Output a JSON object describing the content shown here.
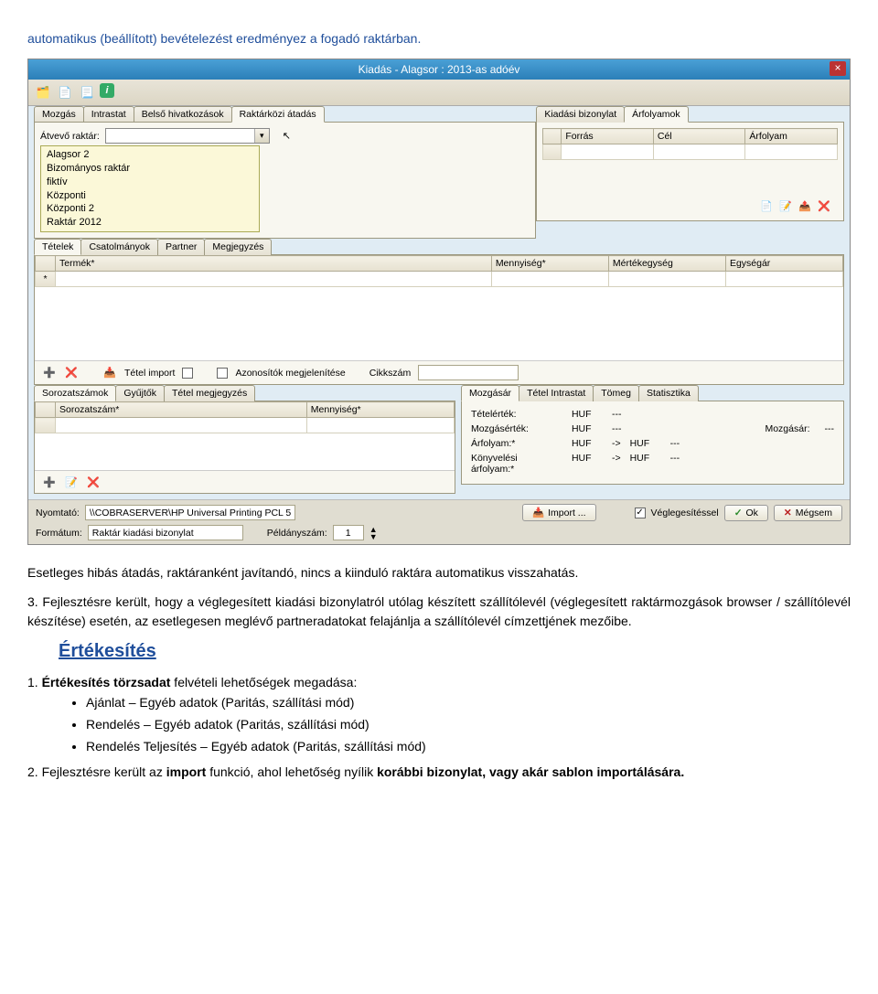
{
  "intro_text": "automatikus (beállított) bevételezést eredményez a fogadó raktárban.",
  "window": {
    "title": "Kiadás - Alagsor : 2013-as adóév",
    "tabs_upper_left": [
      "Mozgás",
      "Intrastat",
      "Belső hivatkozások",
      "Raktárközi átadás"
    ],
    "active_upper_left": "Raktárközi átadás",
    "tabs_upper_right": [
      "Kiadási bizonylat",
      "Árfolyamok"
    ],
    "active_upper_right": "Árfolyamok",
    "atvevo_label": "Átvevő raktár:",
    "dropdown_options": [
      "Alagsor 2",
      "Bizományos raktár",
      "fiktív",
      "Központi",
      "Központi 2",
      "Raktár 2012"
    ],
    "arf_cols": [
      "Forrás",
      "Cél",
      "Árfolyam"
    ],
    "tabs_items": [
      "Tételek",
      "Csatolmányok",
      "Partner",
      "Megjegyzés"
    ],
    "active_items_tab": "Tételek",
    "grid_cols": [
      "Termék*",
      "Mennyiség*",
      "Mértékegység",
      "Egységár"
    ],
    "tetel_import": "Tétel import",
    "azon_megjel": "Azonosítók megjelenítése",
    "cikkszam_label": "Cikkszám",
    "tabs_lower_left": [
      "Sorozatszámok",
      "Gyűjtők",
      "Tétel megjegyzés"
    ],
    "active_lower_left": "Sorozatszámok",
    "lower_left_cols": [
      "Sorozatszám*",
      "Mennyiség*"
    ],
    "tabs_lower_right": [
      "Mozgásár",
      "Tétel Intrastat",
      "Tömeg",
      "Statisztika"
    ],
    "active_lower_right": "Mozgásár",
    "stats": {
      "tetelerték": {
        "label": "Tételérték:",
        "curr": "HUF",
        "val": "---"
      },
      "mozgasertek": {
        "label": "Mozgásérték:",
        "curr": "HUF",
        "val": "---",
        "mozgasar_label": "Mozgásár:",
        "mozgasar_val": "---"
      },
      "arfolyam": {
        "label": "Árfolyam:*",
        "curr": "HUF",
        "arrow": "->",
        "curr2": "HUF",
        "val": "---"
      },
      "konyv": {
        "label": "Könyvelési árfolyam:*",
        "curr": "HUF",
        "arrow": "->",
        "curr2": "HUF",
        "val": "---"
      }
    },
    "footer": {
      "nyomtato_label": "Nyomtató:",
      "nyomtato_value": "\\\\COBRASERVER\\HP Universal Printing PCL 5",
      "formatum_label": "Formátum:",
      "formatum_value": "Raktár kiadási bizonylat",
      "peldany_label": "Példányszám:",
      "peldany_value": "1",
      "import_btn": "Import ...",
      "veglegesites_label": "Véglegesítéssel",
      "ok": "Ok",
      "megsem": "Mégsem"
    }
  },
  "doc": {
    "p_after_window": "Esetleges hibás átadás, raktáranként javítandó, nincs a kiinduló raktára automatikus visszahatás.",
    "p3_num": "3.",
    "p3_body": "Fejlesztésre került, hogy a véglegesített kiadási bizonylatról utólag készített szállítólevél (véglegesített raktármozgások browser / szállítólevél készítése) esetén, az esetlegesen meglévő partneradatokat felajánlja a szállítólevél címzettjének mezőibe.",
    "section": "Értékesítés",
    "p1_num": "1.",
    "p1_body": "Értékesítés törzsadat felvételi lehetőségek megadása:",
    "bullets": [
      "Ajánlat – Egyéb adatok (Paritás, szállítási mód)",
      "Rendelés – Egyéb adatok (Paritás, szállítási mód)",
      "Rendelés Teljesítés – Egyéb adatok (Paritás, szállítási mód)"
    ],
    "p2_num": "2.",
    "p2_bold1": "import",
    "p2_mid": " funkció, ahol lehetőség nyílik ",
    "p2_bold2": "korábbi bizonylat, vagy akár sablon importálására.",
    "p2_pre": "Fejlesztésre került az "
  }
}
